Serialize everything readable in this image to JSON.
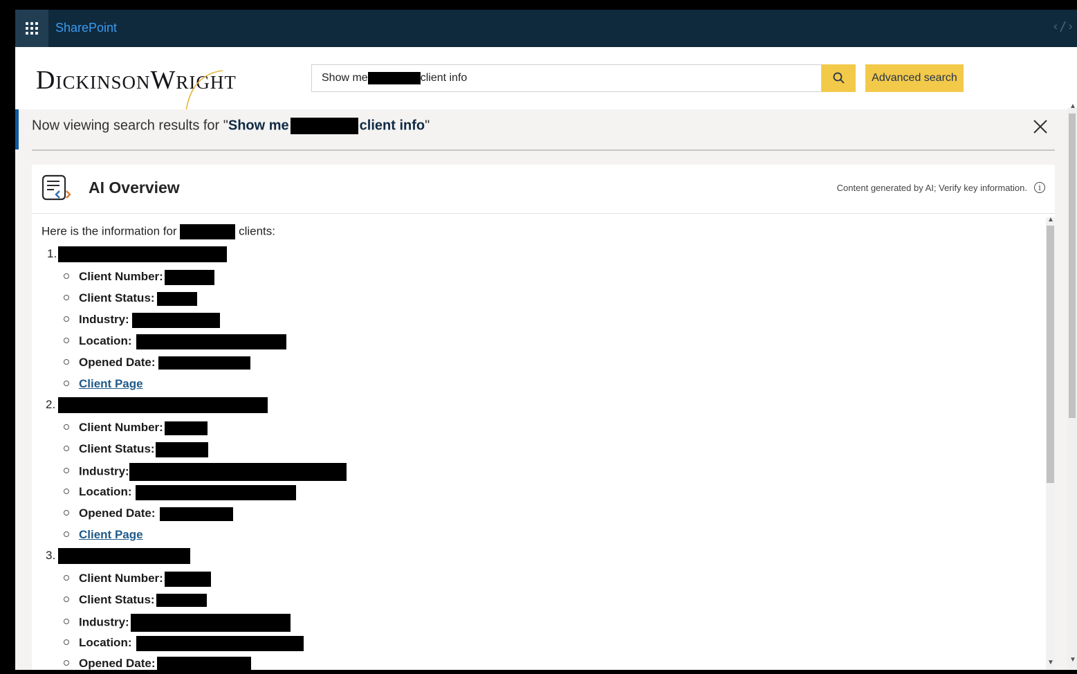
{
  "topbar": {
    "app_name": "SharePoint",
    "code_icon": "code-icon"
  },
  "header": {
    "logo": {
      "first": "D",
      "first_rest": "ICKINSON",
      "second": "W",
      "second_rest": "RIGHT"
    },
    "search": {
      "value_start": "Show me",
      "value_end": "client info",
      "search_icon": "search-icon"
    },
    "advanced_search_label": "Advanced search"
  },
  "banner": {
    "prefix": "Now viewing search results for \"",
    "query_start": "Show me",
    "query_end": "client info",
    "suffix": "\"",
    "close_icon": "close-icon"
  },
  "ai_overview": {
    "title": "AI Overview",
    "disclaimer": "Content generated by AI; Verify key information.",
    "info_icon_glyph": "i",
    "intro_start": "Here is the information for",
    "intro_end": "clients:",
    "clients": [
      {
        "number": "1.",
        "fields": {
          "client_number": "Client Number:",
          "client_status": "Client Status:",
          "industry": "Industry:",
          "location": "Location:",
          "opened_date": "Opened Date:",
          "client_page": "Client Page"
        }
      },
      {
        "number": "2.",
        "fields": {
          "client_number": "Client Number:",
          "client_status": "Client Status:",
          "industry": "Industry:",
          "location": "Location:",
          "opened_date": "Opened Date:",
          "client_page": "Client Page"
        }
      },
      {
        "number": "3.",
        "fields": {
          "client_number": "Client Number:",
          "client_status": "Client Status:",
          "industry": "Industry:",
          "location": "Location:",
          "opened_date": "Opened Date:"
        }
      }
    ]
  },
  "colors": {
    "suite_bar": "#0f293d",
    "app_name": "#3a9cf0",
    "accent_yellow": "#f3c94a",
    "link": "#1f5a8a"
  }
}
